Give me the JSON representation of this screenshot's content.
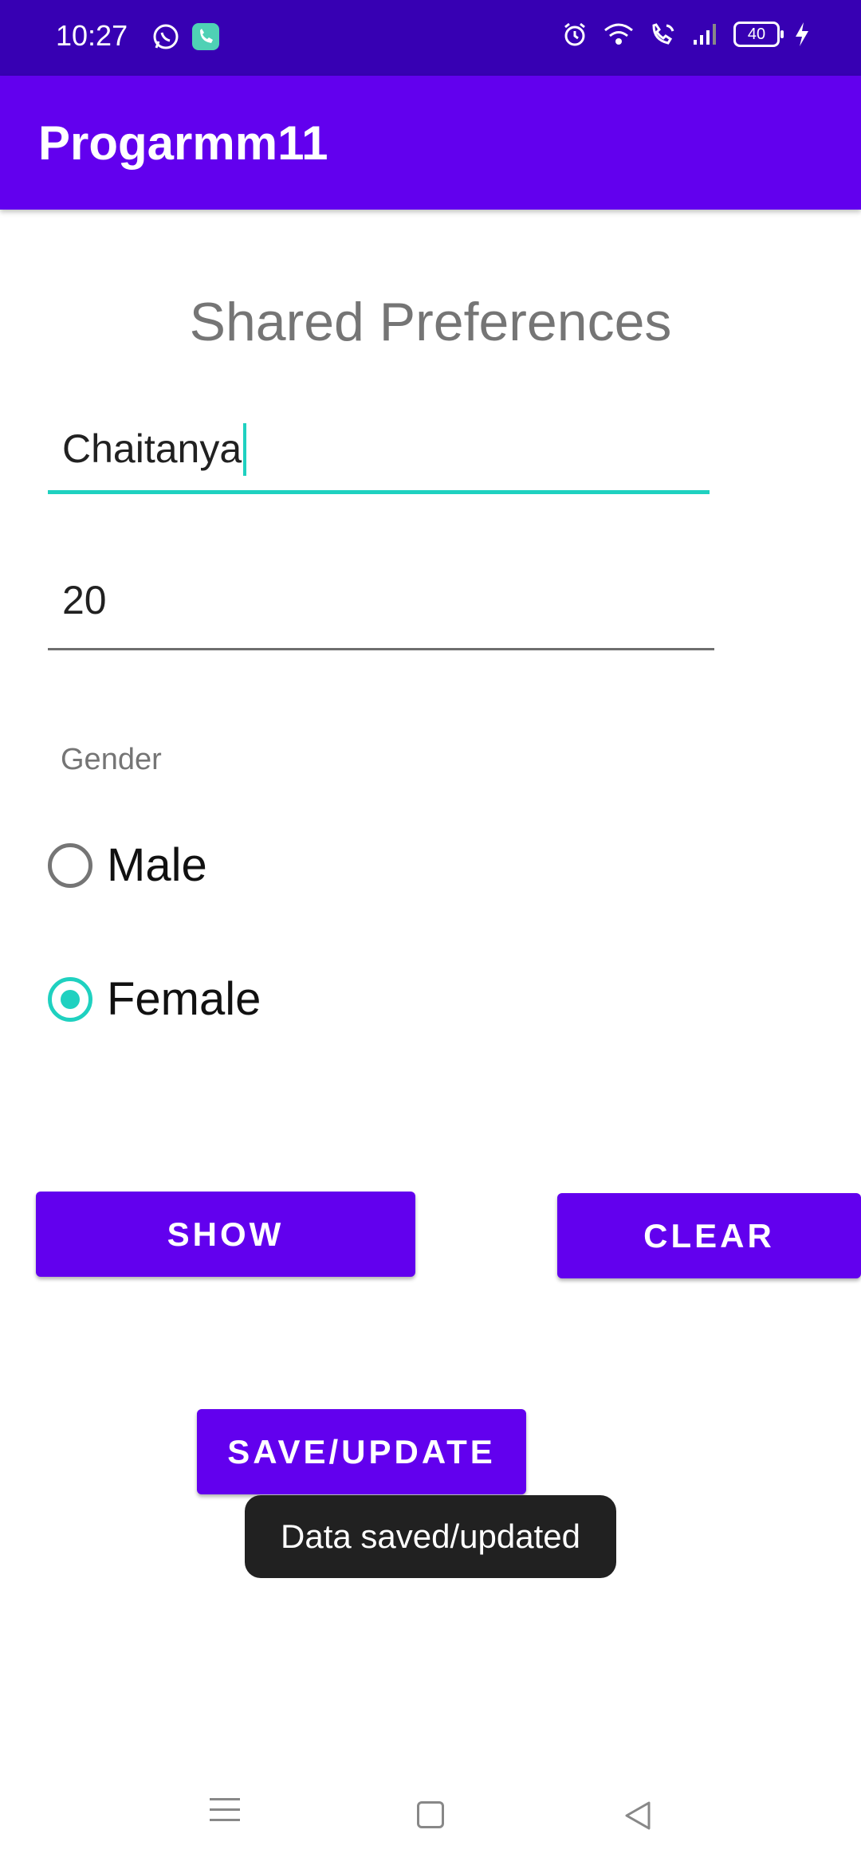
{
  "status_bar": {
    "time": "10:27",
    "battery": "40"
  },
  "app_bar": {
    "title": "Progarmm11"
  },
  "form": {
    "heading": "Shared Preferences",
    "name_value": "Chaitanya",
    "age_value": "20",
    "gender_label": "Gender",
    "options": [
      {
        "label": "Male",
        "selected": false
      },
      {
        "label": "Female",
        "selected": true
      }
    ]
  },
  "buttons": {
    "show": "SHOW",
    "clear": "CLEAR",
    "save": "SAVE/UPDATE"
  },
  "toast": {
    "message": "Data saved/updated"
  },
  "colors": {
    "status_bar": "#3700b3",
    "primary": "#6200ee",
    "accent": "#1fd1c0",
    "toast_bg": "#212121"
  },
  "icons": [
    "whatsapp-icon",
    "phone-call-icon",
    "alarm-icon",
    "wifi-icon",
    "wifi-calling-icon",
    "signal-icon",
    "battery-icon",
    "charging-icon",
    "menu-icon",
    "home-icon",
    "back-icon"
  ]
}
